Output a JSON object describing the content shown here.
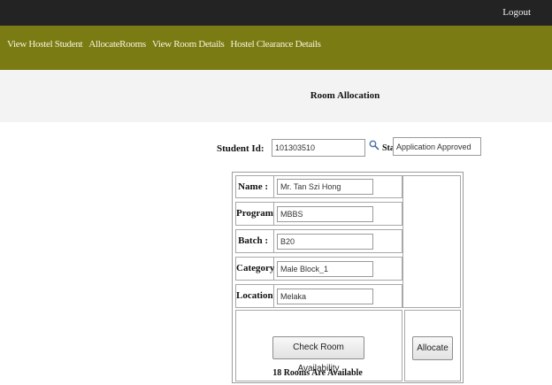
{
  "header": {
    "logout_label": "Logout"
  },
  "nav": {
    "items": [
      "View Hostel Student",
      "AllocateRooms",
      "View Room Details",
      "Hostel Clearance Details"
    ]
  },
  "page": {
    "title": "Room Allocation"
  },
  "student_search": {
    "id_label": "Student Id:",
    "id_value": "101303510",
    "status_label": "Status:",
    "status_value": "Application Approved"
  },
  "details": {
    "name_label": "Name :",
    "name_value": "Mr. Tan Szi Hong",
    "program_label": "Program :",
    "program_value": "MBBS",
    "batch_label": "Batch :",
    "batch_value": "B20",
    "category_label": "Category :",
    "category_value": "Male Block_1",
    "location_label": "Location :",
    "location_value": "Melaka"
  },
  "actions": {
    "check_label": "Check Room Availability",
    "allocate_label": "Allocate",
    "availability_text": "18 Rooms Are Available"
  },
  "colors": {
    "top_bar": "#232323",
    "nav_bar": "#7b7b14",
    "title_bar": "#f3f3f3"
  }
}
